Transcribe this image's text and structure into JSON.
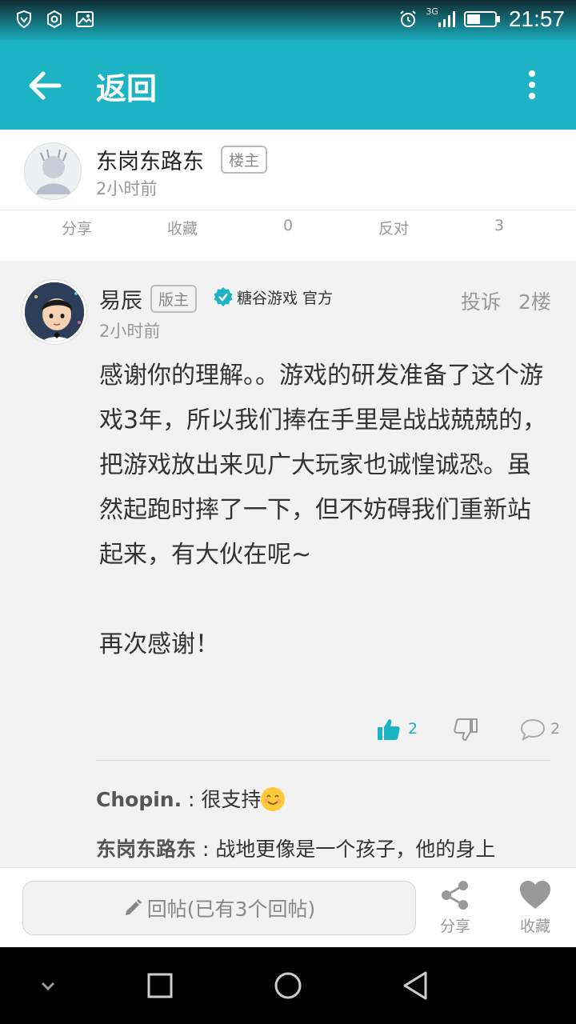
{
  "status_bar": {
    "time": "21:57",
    "network": "3G"
  },
  "app_bar": {
    "title": "返回"
  },
  "op": {
    "name": "东岗东路东",
    "badge": "楼主",
    "time": "2小时前"
  },
  "op_actions": [
    {
      "label": "分享"
    },
    {
      "label": "收藏"
    },
    {
      "label": "0"
    },
    {
      "label": "反对"
    },
    {
      "label": "3"
    }
  ],
  "reply": {
    "name": "易辰",
    "badge": "版主",
    "official": "糖谷游戏 官方",
    "report_label": "投诉",
    "floor": "2楼",
    "time": "2小时前",
    "body": "感谢你的理解。。游戏的研发准备了这个游戏3年，所以我们捧在手里是战战兢兢的，把游戏放出来见广大玩家也诚惶诚恐。虽然起跑时摔了一下，但不妨碍我们重新站起来，有大伙在呢~\n\n再次感谢！",
    "like_count": "2",
    "comment_count": "2",
    "comments": [
      {
        "user": "Chopin.",
        "text": "很支持"
      },
      {
        "user": "东岗东路东",
        "text": "战地更像是一个孩子，他的身上"
      }
    ]
  },
  "bottom_bar": {
    "reply_placeholder": "回帖(已有3个回帖)",
    "share_label": "分享",
    "favorite_label": "收藏"
  },
  "colors": {
    "accent": "#1cb4c4",
    "background": "#f2f2f2"
  }
}
